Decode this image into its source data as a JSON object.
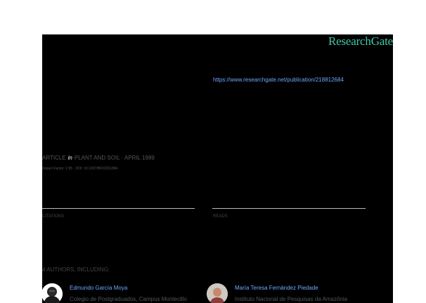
{
  "brand": {
    "logo_text": "ResearchGate",
    "accent_color": "#3fc7a7",
    "link_color": "#6fa8ff"
  },
  "publication": {
    "url": "https://www.researchgate.net/publication/218812684",
    "article_prefix": "ARTICLE",
    "article_in": "in",
    "journal_line": "PLANT AND SOIL · APRIL 1989",
    "impact_line": "Impact Factor: 2.95 · DOI: 10.1007/BF02201884"
  },
  "stats": {
    "citations_label": "CITATIONS",
    "reads_label": "READS"
  },
  "authors": {
    "heading": "4 AUTHORS, INCLUDING:",
    "items": [
      {
        "name": "Edmundo García Moya",
        "institution": "Colegio de Postgraduados, Campus Montecillo",
        "avatar_icon": "person-photo-icon"
      },
      {
        "name": "María Teresa Fernández Piedade",
        "institution": "Instituto Nacional de Pesquisas da Amazônia",
        "avatar_icon": "person-photo-icon"
      }
    ]
  }
}
